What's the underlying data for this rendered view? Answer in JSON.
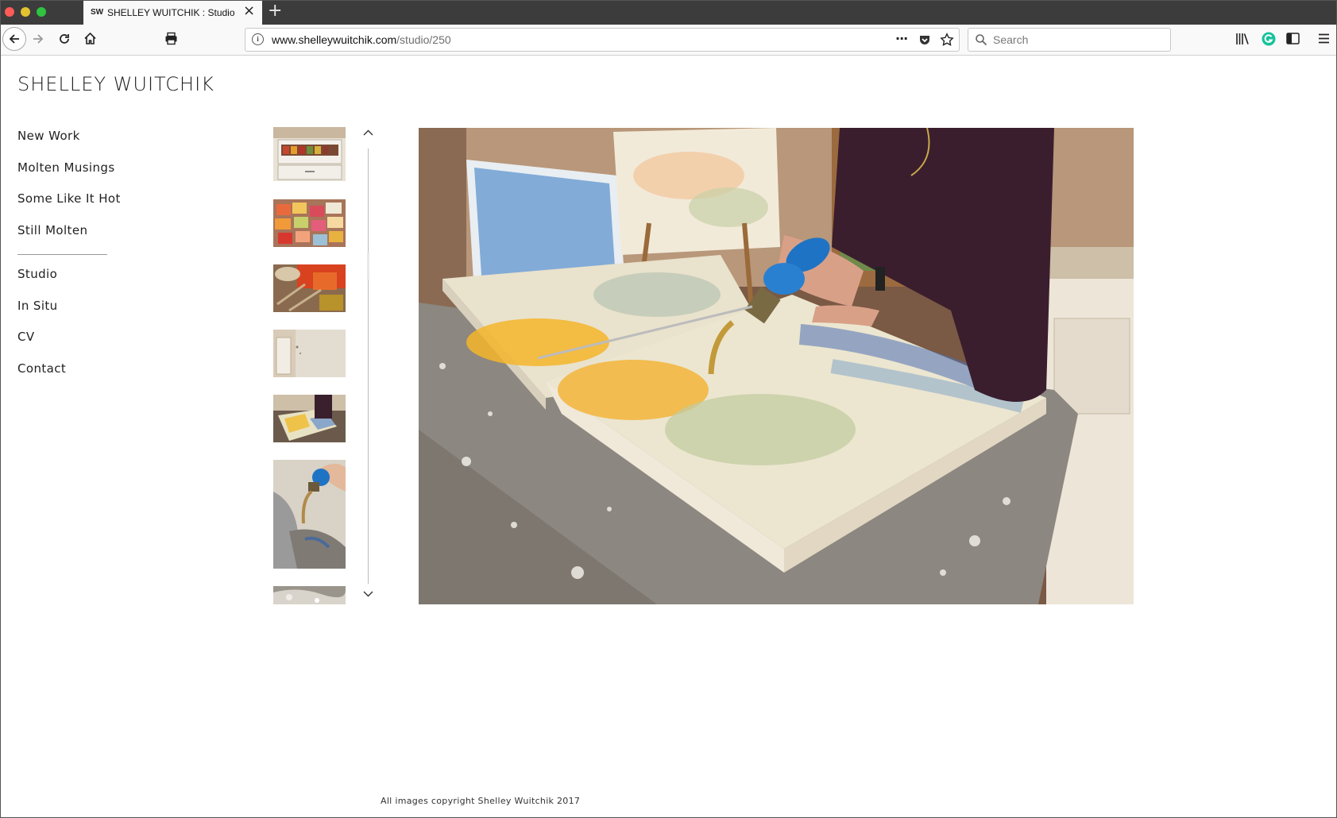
{
  "browser": {
    "tab": {
      "favicon_text": "SW",
      "title": "SHELLEY WUITCHIK : Studio"
    },
    "url": {
      "host": "www.shelleywuitchik.com",
      "path": "/studio/250"
    },
    "search_placeholder": "Search"
  },
  "site": {
    "title": "SHELLEY WUITCHIK",
    "nav_primary": [
      "New Work",
      "Molten Musings",
      "Some Like It Hot",
      "Still Molten"
    ],
    "nav_secondary": [
      "Studio",
      "In Situ",
      "CV",
      "Contact"
    ]
  },
  "gallery": {
    "thumbnail_count": 7,
    "scroll_up_glyph": "^",
    "scroll_down_glyph": "v"
  },
  "footer": {
    "text": "All images copyright Shelley Wuitchik 2017"
  },
  "colors": {
    "tab_strip": "#3c3c3c",
    "toolbar": "#f9f9fa",
    "grammarly": "#15c39a"
  }
}
